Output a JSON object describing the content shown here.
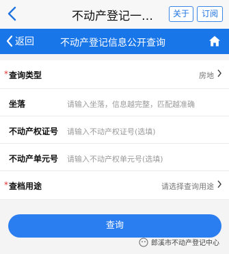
{
  "wechat_bar": {
    "title": "不动产登记一…",
    "about_label": "关于",
    "subscribe_label": "订阅"
  },
  "nav": {
    "back_label": "返回",
    "title": "不动产登记信息公开查询"
  },
  "form": {
    "fields": [
      {
        "label": "查询类型",
        "required": true,
        "value": "房地",
        "placeholder": ""
      },
      {
        "label": "坐落",
        "required": false,
        "value": "",
        "placeholder": "请输入坐落，信息越完整，匹配越准确"
      },
      {
        "label": "不动产权证号",
        "required": false,
        "value": "",
        "placeholder": "请输入不动产权证号(选填)"
      },
      {
        "label": "不动产单元号",
        "required": false,
        "value": "",
        "placeholder": "请输入不动产权单元号(选填)"
      },
      {
        "label": "查档用途",
        "required": true,
        "value": "请选择查询用途",
        "placeholder": ""
      }
    ]
  },
  "query_button_label": "查询",
  "watermark": "郎溪市不动产登记中心",
  "colors": {
    "primary": "#1976e8",
    "button": "#2b7ef0",
    "required": "#e23030"
  }
}
